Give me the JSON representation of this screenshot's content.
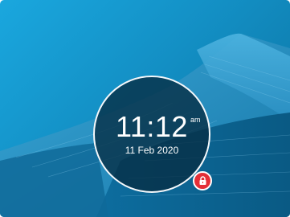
{
  "lockscreen": {
    "time": "11:12",
    "ampm": "am",
    "date": "11 Feb 2020"
  },
  "icons": {
    "lock": "lock-icon"
  },
  "colors": {
    "sky": "#1aa7de",
    "building_light": "#2f9bcd",
    "building_dark": "#0a5b84",
    "clock_overlay": "#062d42",
    "ring": "#f4f8fb",
    "lock_badge": "#e42f37"
  }
}
